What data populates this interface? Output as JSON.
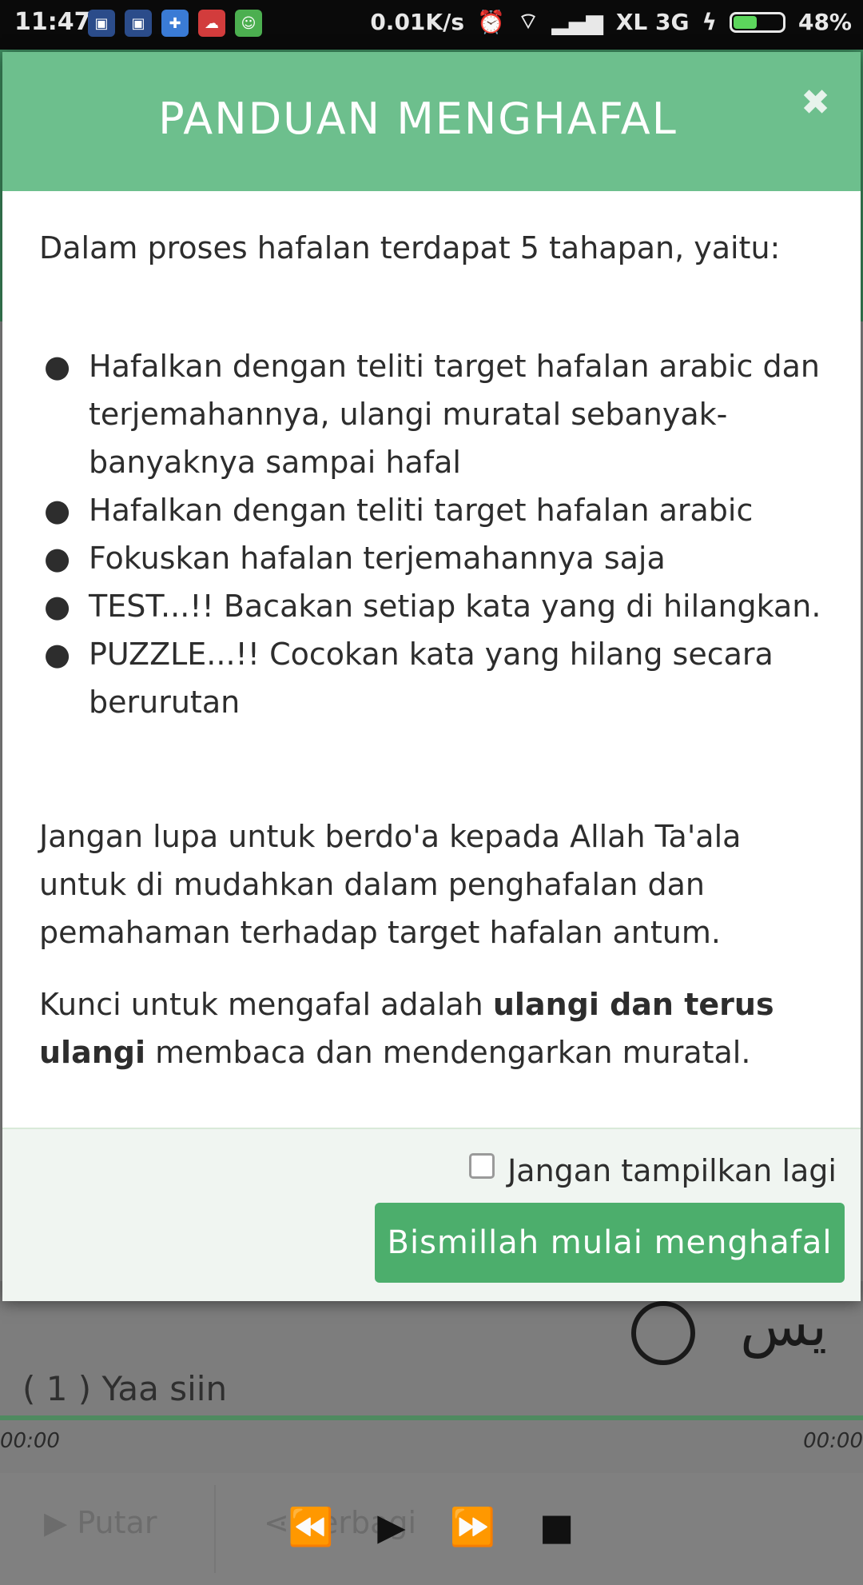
{
  "status_bar": {
    "time": "11:47",
    "net_speed": "0.01K/s",
    "carrier": "XL 3G",
    "battery_percent": "48%",
    "battery_level": 0.48
  },
  "background": {
    "verse_label": "( 1 ) Yaa siin",
    "arabic": "يس",
    "time_left": "00:00",
    "time_right": "00:00",
    "btn_play_label": "Putar",
    "btn_share_label": "Berbagi"
  },
  "modal": {
    "title": "PANDUAN MENGHAFAL",
    "close_glyph": "✖",
    "intro": "Dalam proses hafalan terdapat 5 tahapan, yaitu:",
    "steps": [
      "Hafalkan dengan teliti target hafalan arabic dan terjemahannya, ulangi muratal sebanyak-banyaknya sampai hafal",
      "Hafalkan dengan teliti target hafalan arabic",
      "Fokuskan hafalan terjemahannya saja",
      "TEST...!! Bacakan setiap kata yang di hilangkan.",
      "PUZZLE...!! Cocokan kata yang hilang secara berurutan"
    ],
    "paragraph_1": "Jangan lupa untuk berdo'a kepada Allah Ta'ala untuk di mudahkan dalam penghafalan dan pemahaman terhadap target hafalan antum.",
    "paragraph_2_prefix": "Kunci untuk mengafal adalah ",
    "paragraph_2_bold": "ulangi dan terus ulangi",
    "paragraph_2_suffix": " membaca dan mendengarkan muratal.",
    "dont_show_label": "Jangan tampilkan lagi",
    "start_button_label": "Bismillah mulai menghafal"
  },
  "colors": {
    "header_green": "#6dbf8d",
    "button_green": "#4cae6c"
  }
}
